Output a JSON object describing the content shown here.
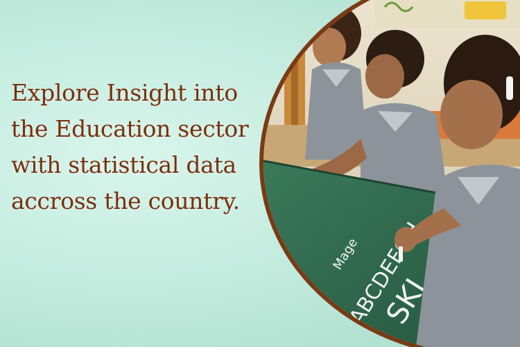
{
  "banner": {
    "headline_lines": [
      "Explore Insight into",
      "the Education sector",
      "with statistical data",
      "accross the country."
    ],
    "chalk_words": [
      "ABCDEFGH",
      "SKL",
      "Mage"
    ],
    "colors": {
      "background": "#bfe9dc",
      "headline": "#7a2f0c",
      "border": "#7a3a14",
      "board": "#2f6b4e",
      "uniform": "#8d939a"
    }
  }
}
